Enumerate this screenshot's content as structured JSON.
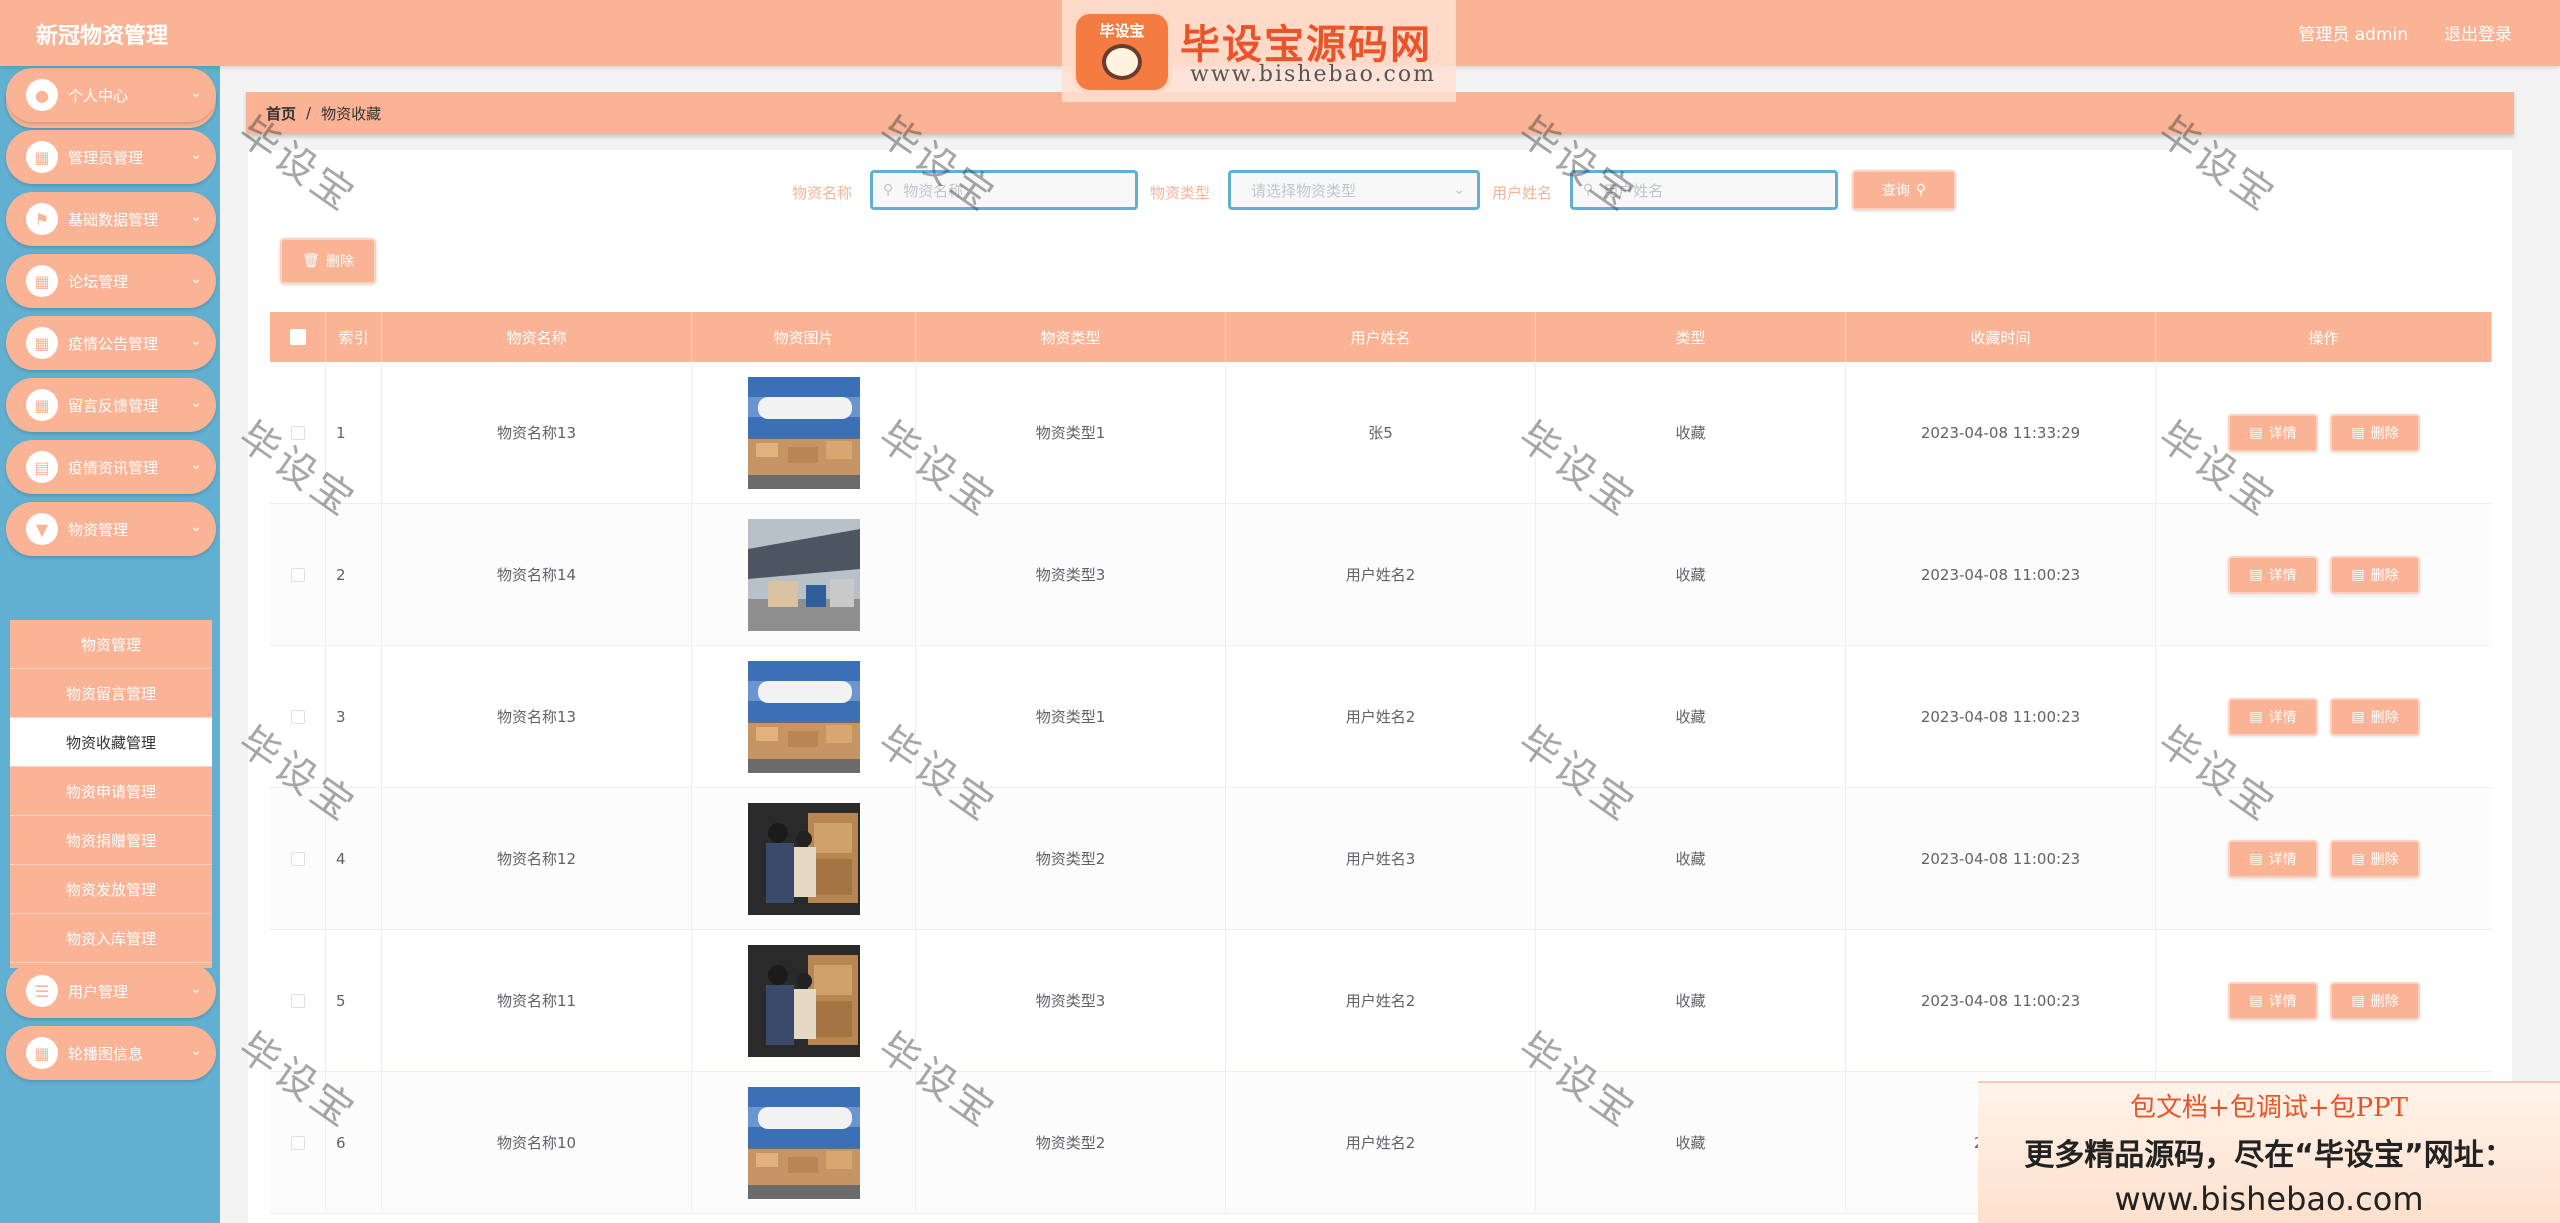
{
  "header": {
    "title": "新冠物资管理",
    "user_label": "管理员 admin",
    "logout_label": "退出登录"
  },
  "watermark_logo": {
    "badge": "毕设宝",
    "title": "毕设宝源码网",
    "url": "www.bishebao.com"
  },
  "sidebar": {
    "home": "首页",
    "items": [
      {
        "label": "个人中心",
        "icon": "person-icon"
      },
      {
        "label": "管理员管理",
        "icon": "grid-icon"
      },
      {
        "label": "基础数据管理",
        "icon": "flag-icon"
      },
      {
        "label": "论坛管理",
        "icon": "grid-icon"
      },
      {
        "label": "疫情公告管理",
        "icon": "grid-icon"
      },
      {
        "label": "留言反馈管理",
        "icon": "grid-icon"
      },
      {
        "label": "疫情资讯管理",
        "icon": "doc-icon"
      },
      {
        "label": "物资管理",
        "icon": "cup-icon"
      },
      {
        "label": "用户管理",
        "icon": "list-icon"
      },
      {
        "label": "轮播图信息",
        "icon": "grid-icon"
      }
    ],
    "submenu": [
      "物资管理",
      "物资留言管理",
      "物资收藏管理",
      "物资申请管理",
      "物资捐赠管理",
      "物资发放管理",
      "物资入库管理"
    ]
  },
  "breadcrumb": {
    "home": "首页",
    "sep": "/",
    "current": "物资收藏"
  },
  "search": {
    "name_label": "物资名称",
    "name_placeholder": "物资名称",
    "type_label": "物资类型",
    "type_placeholder": "请选择物资类型",
    "user_label": "用户姓名",
    "user_placeholder": "用户姓名",
    "query_button": "查询"
  },
  "toolbar": {
    "delete_button": "删除"
  },
  "table": {
    "headers": [
      "索引",
      "物资名称",
      "物资图片",
      "物资类型",
      "用户姓名",
      "类型",
      "收藏时间",
      "操作"
    ],
    "detail_label": "详情",
    "delete_label": "删除",
    "rows": [
      {
        "index": "1",
        "name": "物资名称13",
        "image": "plane",
        "type": "物资类型1",
        "user": "张5",
        "kind": "收藏",
        "time": "2023-04-08 11:33:29"
      },
      {
        "index": "2",
        "name": "物资名称14",
        "image": "cargo",
        "type": "物资类型3",
        "user": "用户姓名2",
        "kind": "收藏",
        "time": "2023-04-08 11:00:23"
      },
      {
        "index": "3",
        "name": "物资名称13",
        "image": "plane",
        "type": "物资类型1",
        "user": "用户姓名2",
        "kind": "收藏",
        "time": "2023-04-08 11:00:23"
      },
      {
        "index": "4",
        "name": "物资名称12",
        "image": "workers",
        "type": "物资类型2",
        "user": "用户姓名3",
        "kind": "收藏",
        "time": "2023-04-08 11:00:23"
      },
      {
        "index": "5",
        "name": "物资名称11",
        "image": "workers",
        "type": "物资类型3",
        "user": "用户姓名2",
        "kind": "收藏",
        "time": "2023-04-08 11:00:23"
      },
      {
        "index": "6",
        "name": "物资名称10",
        "image": "plane",
        "type": "物资类型2",
        "user": "用户姓名2",
        "kind": "收藏",
        "time": "2023-0"
      }
    ]
  },
  "watermark_text": "毕设宝",
  "ad": {
    "line1": "包文档+包调试+包PPT",
    "line2": "更多精品源码，尽在“毕设宝”网址：",
    "line3": "www.bishebao.com"
  },
  "colors": {
    "accent": "#fbb396",
    "sidebar": "#61b0d1",
    "border_highlight": "#61b0d1"
  }
}
